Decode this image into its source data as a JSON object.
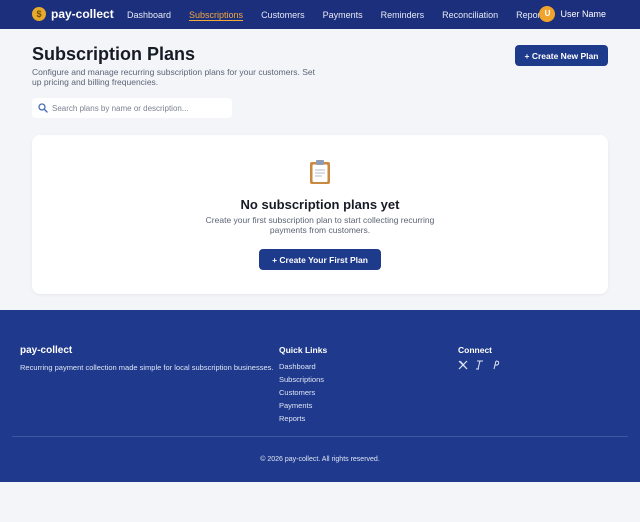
{
  "header": {
    "brand": "pay-collect",
    "nav": [
      {
        "label": "Dashboard",
        "active": false
      },
      {
        "label": "Subscriptions",
        "active": true
      },
      {
        "label": "Customers",
        "active": false
      },
      {
        "label": "Payments",
        "active": false
      },
      {
        "label": "Reminders",
        "active": false
      },
      {
        "label": "Reconciliation",
        "active": false
      },
      {
        "label": "Reports",
        "active": false
      }
    ],
    "avatar_initial": "U",
    "user_name": "User Name"
  },
  "main": {
    "title": "Subscription Plans",
    "subtitle": "Configure and manage recurring subscription plans for your customers. Set up pricing and billing frequencies.",
    "create_button": "+ Create New Plan",
    "search_placeholder": "Search plans by name or description...",
    "empty_state": {
      "icon": "clipboard-icon",
      "title": "No subscription plans yet",
      "description": "Create your first subscription plan to start collecting recurring payments from customers.",
      "button": "+ Create Your First Plan"
    }
  },
  "footer": {
    "brand": "pay-collect",
    "tagline": "Recurring payment collection made simple for local subscription businesses.",
    "quick_links_title": "Quick Links",
    "quick_links": [
      "Dashboard",
      "Subscriptions",
      "Customers",
      "Payments",
      "Reports"
    ],
    "connect_title": "Connect",
    "social": [
      "x-icon",
      "threads-icon",
      "pinterest-icon"
    ],
    "copyright": "© 2026 pay-collect. All rights reserved."
  },
  "colors": {
    "primary": "#1e3a8a",
    "nav_bg": "#1c2f7c",
    "accent": "#f2a93b",
    "page_bg": "#f3f5f9"
  }
}
